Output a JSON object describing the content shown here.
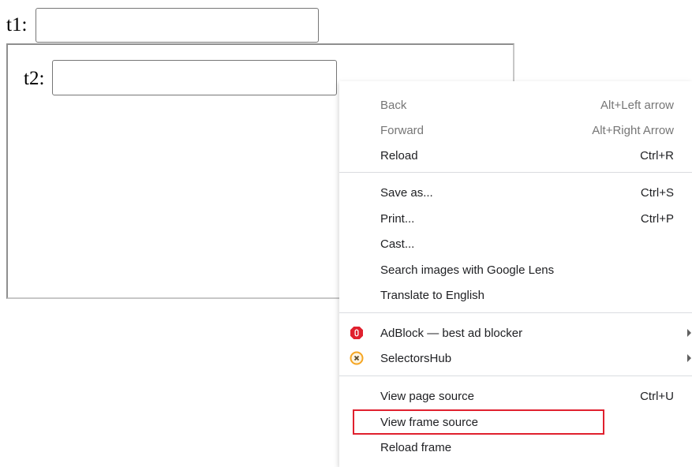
{
  "page": {
    "t1_label": "t1:",
    "t1_value": "",
    "frame": {
      "t2_label": "t2:",
      "t2_value": ""
    }
  },
  "context_menu": {
    "items": [
      {
        "label": "Back",
        "shortcut": "Alt+Left arrow",
        "disabled": true
      },
      {
        "label": "Forward",
        "shortcut": "Alt+Right Arrow",
        "disabled": true
      },
      {
        "label": "Reload",
        "shortcut": "Ctrl+R"
      },
      {
        "label": "Save as...",
        "shortcut": "Ctrl+S"
      },
      {
        "label": "Print...",
        "shortcut": "Ctrl+P"
      },
      {
        "label": "Cast..."
      },
      {
        "label": "Search images with Google Lens"
      },
      {
        "label": "Translate to English"
      },
      {
        "label": "AdBlock — best ad blocker",
        "icon": "adblock-icon",
        "submenu": true
      },
      {
        "label": "SelectorsHub",
        "icon": "selectorshub-icon",
        "submenu": true
      },
      {
        "label": "View page source",
        "shortcut": "Ctrl+U"
      },
      {
        "label": "View frame source",
        "highlighted": true
      },
      {
        "label": "Reload frame"
      }
    ]
  },
  "colors": {
    "highlight_border": "#e0202e",
    "adblock_red": "#e0202e",
    "selectorshub_orange": "#f5a623"
  }
}
